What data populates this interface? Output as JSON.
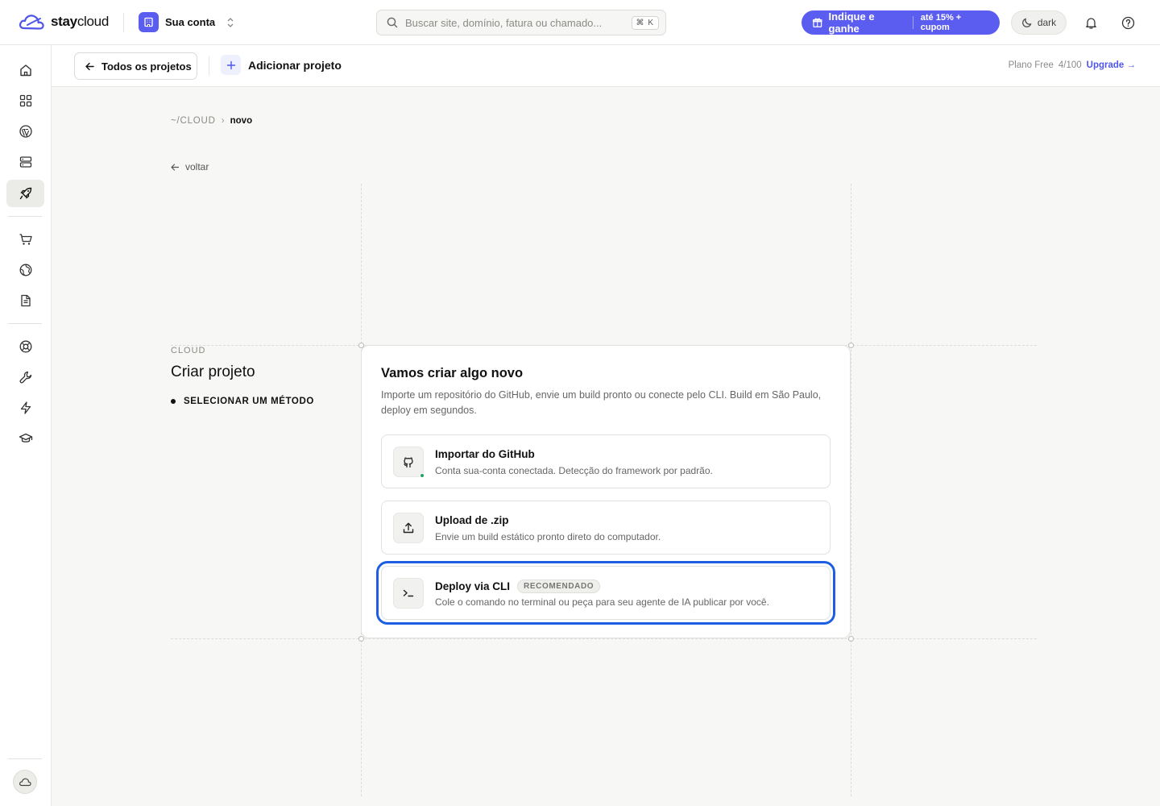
{
  "brand": {
    "logo_bold": "stay",
    "logo_light": "cloud",
    "accent": "#5b5cf0"
  },
  "account": {
    "name": "Sua conta"
  },
  "search": {
    "placeholder": "Buscar site, domínio, fatura ou chamado...",
    "shortcut": "⌘ K"
  },
  "referral": {
    "label": "Indique e ganhe",
    "sub": "até 15% + cupom"
  },
  "theme_toggle": {
    "label": "dark"
  },
  "sidebar": {
    "items": [
      {
        "name": "home-icon"
      },
      {
        "name": "dashboard-icon"
      },
      {
        "name": "wordpress-icon"
      },
      {
        "name": "server-icon"
      },
      {
        "name": "rocket-icon",
        "active": true
      },
      {
        "name": "cart-icon"
      },
      {
        "name": "globe-icon"
      },
      {
        "name": "document-icon"
      },
      {
        "name": "lifebuoy-icon"
      },
      {
        "name": "wrench-icon"
      },
      {
        "name": "bolt-icon"
      },
      {
        "name": "graduation-cap-icon"
      }
    ]
  },
  "subheader": {
    "all_projects": "Todos os projetos",
    "add_project": "Adicionar projeto",
    "plan_label": "Plano Free",
    "plan_usage": "4/100",
    "upgrade": "Upgrade →"
  },
  "breadcrumb": {
    "root": "~/CLOUD",
    "separator": "›",
    "current": "novo"
  },
  "back_link": "voltar",
  "section": {
    "tag": "CLOUD",
    "title": "Criar projeto",
    "step": "SELECIONAR UM MÉTODO"
  },
  "card": {
    "title": "Vamos criar algo novo",
    "description": "Importe um repositório do GitHub, envie um build pronto ou conecte pelo CLI. Build em São Paulo, deploy em segundos.",
    "options": [
      {
        "title": "Importar do GitHub",
        "desc": "Conta sua-conta conectada. Detecção do framework por padrão.",
        "icon": "github-icon"
      },
      {
        "title": "Upload de .zip",
        "desc": "Envie um build estático pronto direto do computador.",
        "icon": "upload-icon"
      },
      {
        "title": "Deploy via CLI",
        "badge": "RECOMENDADO",
        "desc": "Cole o comando no terminal ou peça para seu agente de IA publicar por você.",
        "icon": "terminal-icon",
        "selected": true
      }
    ]
  }
}
